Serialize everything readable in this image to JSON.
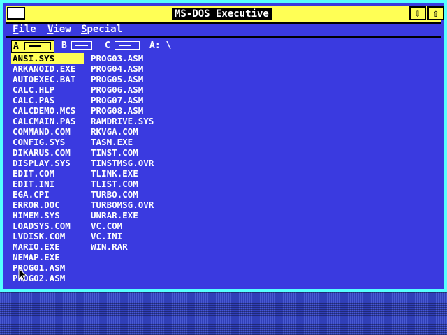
{
  "window": {
    "title": "MS-DOS Executive",
    "minimize_glyph": "⇩",
    "maximize_glyph": "⇧"
  },
  "menu": {
    "items": [
      "File",
      "View",
      "Special"
    ]
  },
  "drives": {
    "items": [
      {
        "letter": "A",
        "selected": true
      },
      {
        "letter": "B",
        "selected": false
      },
      {
        "letter": "C",
        "selected": false
      }
    ],
    "current_path": "A: \\"
  },
  "files": {
    "column1": [
      "ANSI.SYS",
      "ARKANOID.EXE",
      "AUTOEXEC.BAT",
      "CALC.HLP",
      "CALC.PAS",
      "CALCDEMO.MCS",
      "CALCMAIN.PAS",
      "COMMAND.COM",
      "CONFIG.SYS",
      "DIKARUS.COM",
      "DISPLAY.SYS",
      "EDIT.COM",
      "EDIT.INI",
      "EGA.CPI",
      "ERROR.DOC",
      "HIMEM.SYS",
      "LOADSYS.COM",
      "LVDISK.COM",
      "MARIO.EXE",
      "NEMAP.EXE",
      "PROG01.ASM",
      "PROG02.ASM"
    ],
    "column2": [
      "PROG03.ASM",
      "PROG04.ASM",
      "PROG05.ASM",
      "PROG06.ASM",
      "PROG07.ASM",
      "PROG08.ASM",
      "RAMDRIVE.SYS",
      "RKVGA.COM",
      "TASM.EXE",
      "TINST.COM",
      "TINSTMSG.OVR",
      "TLINK.EXE",
      "TLIST.COM",
      "TURBO.COM",
      "TURBOMSG.OVR",
      "UNRAR.EXE",
      "VC.COM",
      "VC.INI",
      "WIN.RAR"
    ],
    "selected": "ANSI.SYS"
  },
  "colors": {
    "window_bg": "#3a3ae0",
    "title_bar": "#ffff55",
    "border": "#55ffff",
    "selection": "#ffff55",
    "text": "#ffffff"
  }
}
